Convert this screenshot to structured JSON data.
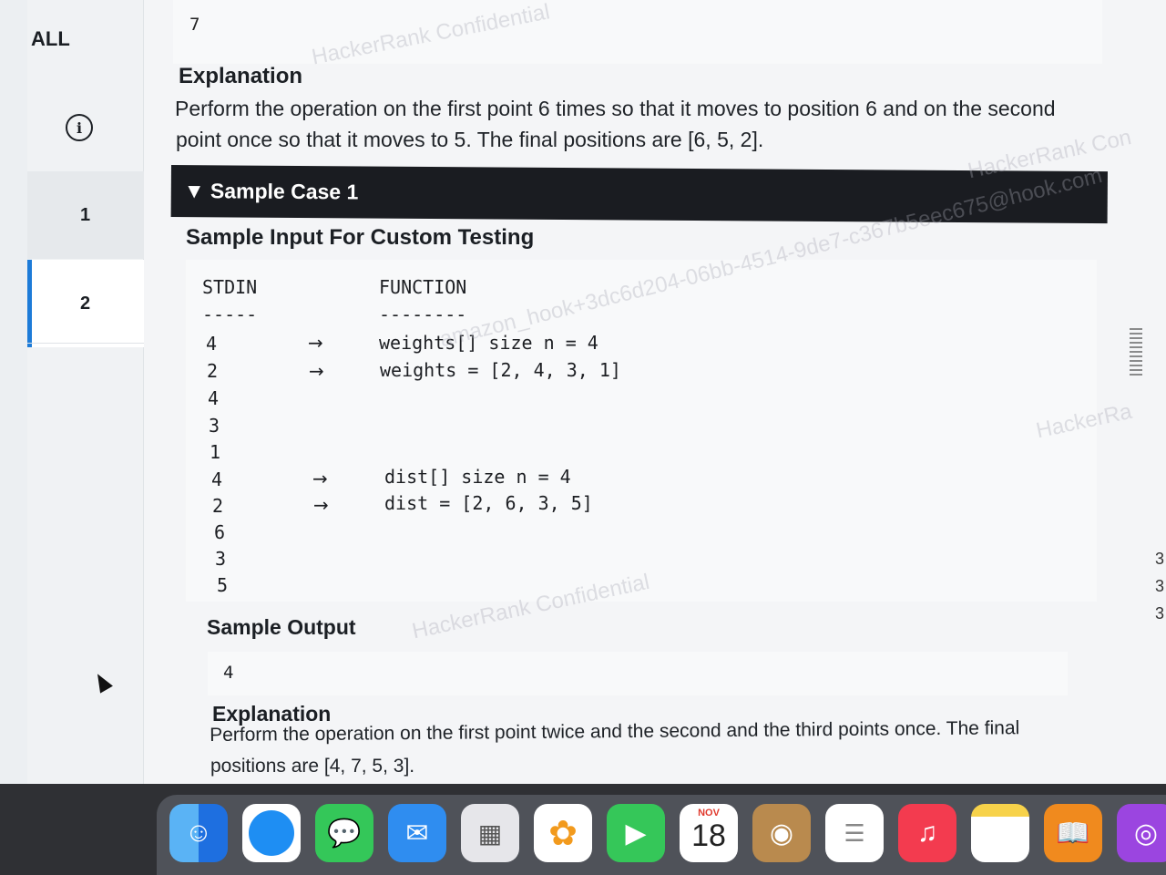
{
  "nav": {
    "all_label": "ALL",
    "info_icon": "i",
    "questions": [
      "1",
      "2"
    ],
    "active_question": "2"
  },
  "prev": {
    "output_value": "7",
    "explanation_heading": "Explanation",
    "explanation_line1": "Perform the operation on the first point 6 times so that it moves to position 6 and on the second",
    "explanation_line2": "point once so that it moves to 5. The final positions are [6, 5, 2]."
  },
  "sample_case": {
    "toggle_label": "▼ Sample Case 1",
    "input_heading": "Sample Input For Custom Testing",
    "col_stdin": "STDIN",
    "col_function": "FUNCTION",
    "stdin_rule": "-----",
    "function_rule": "--------",
    "stdin_values": [
      "4",
      "2",
      "4",
      "3",
      "1",
      "4",
      "2",
      "6",
      "3",
      "5"
    ],
    "arrow": "→",
    "func_weights_size": "weights[] size n = 4",
    "func_weights": "weights = [2, 4, 3, 1]",
    "func_dist_size": "dist[] size n = 4",
    "func_dist": "dist = [2, 6, 3, 5]",
    "output_heading": "Sample Output",
    "output_value": "4",
    "explanation_heading": "Explanation",
    "explanation_line1": "Perform the operation on the first point twice and the second and the third points once. The final",
    "explanation_line2": "positions are [4, 7, 5, 3]."
  },
  "watermarks": {
    "w1": "HackerRank Confidential",
    "w2": "amazon_hook+3dc6d204-06bb-4514-9de7-c367b5eec675@hook.com",
    "w3": "HackerRank Con",
    "w4": "HackerRa"
  },
  "dock": {
    "calendar_month": "NOV",
    "calendar_day": "18",
    "apps": [
      "finder-icon",
      "safari-icon",
      "messages-icon",
      "mail-icon",
      "launchpad-icon",
      "photos-icon",
      "facetime-icon",
      "calendar-icon",
      "contacts-icon",
      "reminders-icon",
      "music-icon",
      "notes-icon",
      "books-icon",
      "podcasts-icon"
    ]
  }
}
